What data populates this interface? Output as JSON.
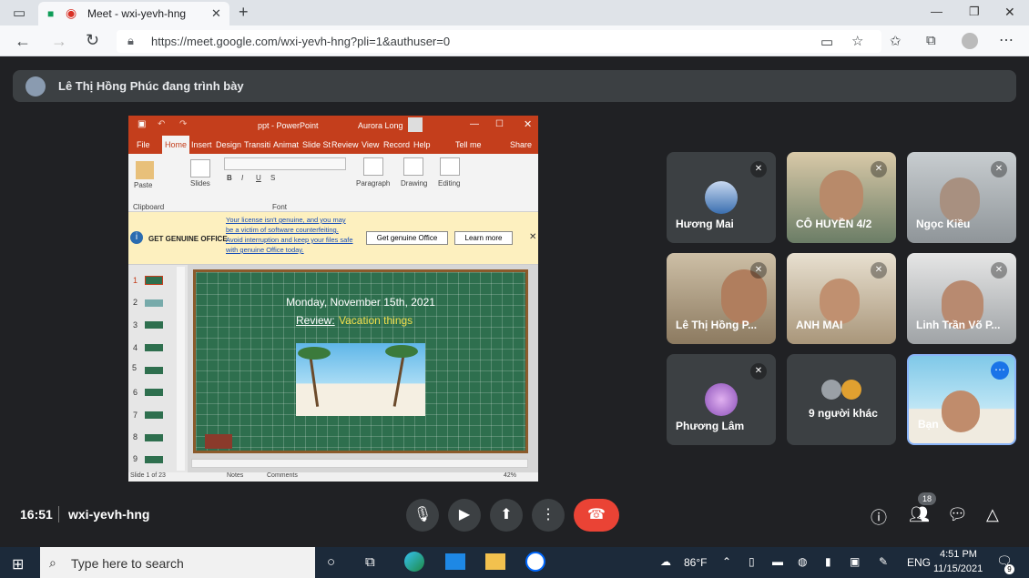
{
  "browser": {
    "tab_title": "Meet - wxi-yevh-hng",
    "url": "https://meet.google.com/wxi-yevh-hng?pli=1&authuser=0"
  },
  "meet": {
    "presenter_text": "Lê Thị Hồng Phúc đang trình bày",
    "time": "16:51",
    "meeting_code": "wxi-yevh-hng",
    "participants_count": "18",
    "tiles": [
      {
        "name": "Hương Mai"
      },
      {
        "name": "CÔ HUYỀN 4/2"
      },
      {
        "name": "Ngọc Kiều"
      },
      {
        "name": "Lê Thị Hồng P..."
      },
      {
        "name": "ANH MAI"
      },
      {
        "name": "Linh Trần Võ P..."
      },
      {
        "name": "Phương Lâm"
      },
      {
        "name": "9 người khác"
      },
      {
        "name": "Bạn"
      }
    ]
  },
  "powerpoint": {
    "title": "ppt - PowerPoint",
    "user": "Aurora Long",
    "tabs": [
      "File",
      "Home",
      "Insert",
      "Design",
      "Transiti",
      "Animat",
      "Slide St",
      "Review",
      "View",
      "Record",
      "Help",
      "Tell me",
      "Share"
    ],
    "ribbon": {
      "paste": "Paste",
      "clipboard": "Clipboard",
      "slides": "Slides",
      "font": "Font",
      "paragraph": "Paragraph",
      "drawing": "Drawing",
      "editing": "Editing"
    },
    "warning_title": "GET GENUINE OFFICE",
    "warning_text": "Your license isn't genuine, and you may be a victim of software counterfeiting. Avoid interruption and keep your files safe with genuine Office today.",
    "btn_get": "Get genuine Office",
    "btn_learn": "Learn more",
    "slide_numbers": [
      "1",
      "2",
      "3",
      "4",
      "5",
      "6",
      "7",
      "8",
      "9"
    ],
    "slide_line1": "Monday, November 15th, 2021",
    "slide_review": "Review:",
    "slide_topic": "Vacation things",
    "status_left": "Slide 1 of 23",
    "status_notes": "Notes",
    "status_comments": "Comments",
    "zoom": "42%"
  },
  "taskbar": {
    "search_placeholder": "Type here to search",
    "weather": "86°F",
    "lang": "ENG",
    "clock_time": "4:51 PM",
    "clock_date": "11/15/2021",
    "notif_count": "9"
  }
}
